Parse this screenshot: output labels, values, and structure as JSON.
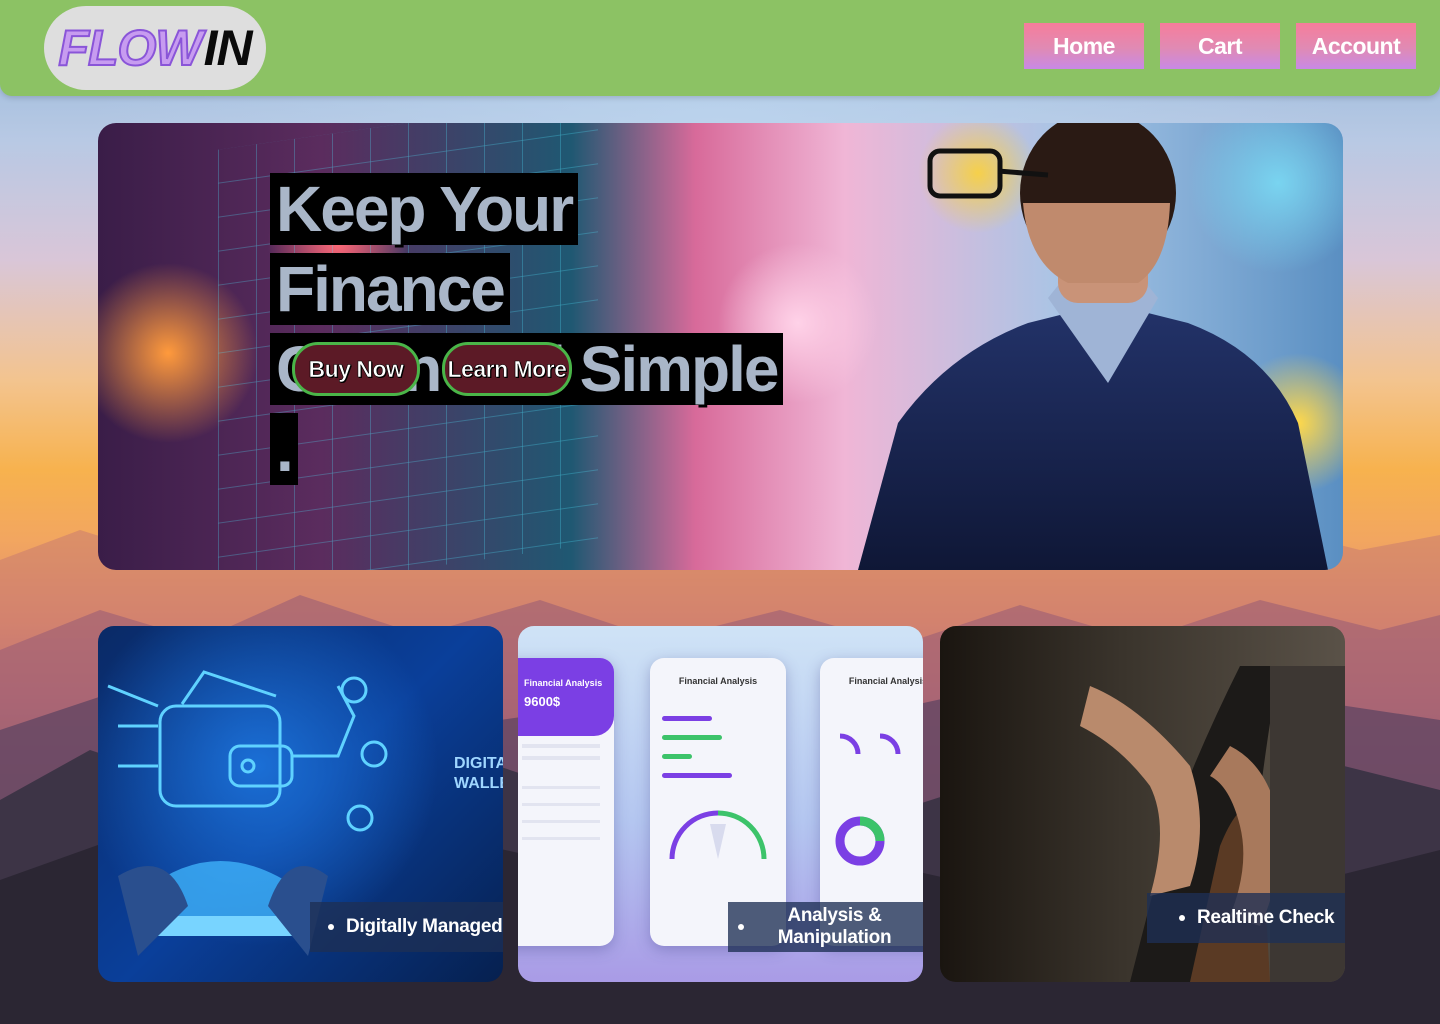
{
  "header": {
    "logo_part1": "FLOW",
    "logo_part2": "IN",
    "nav": [
      "Home",
      "Cart",
      "Account"
    ]
  },
  "hero": {
    "title_line1": "Keep Your Finance",
    "title_line2": "Clean  and Simple .",
    "buy_button": "Buy Now",
    "learn_button": "Learn More"
  },
  "cards": [
    {
      "label": "Digitally  Managed",
      "image_text": "DIGITAL WALLET"
    },
    {
      "label": "Analysis & Manipulation",
      "app_title": "Financial Analysis",
      "balance": "9600$"
    },
    {
      "label": "Realtime Check"
    }
  ],
  "colors": {
    "header_bg": "#8cc264",
    "nav_gradient_top": "#f77d9a",
    "nav_gradient_bottom": "#c889e6",
    "hero_button_border": "#4ab548",
    "card_label_bg": "#1e3054"
  }
}
